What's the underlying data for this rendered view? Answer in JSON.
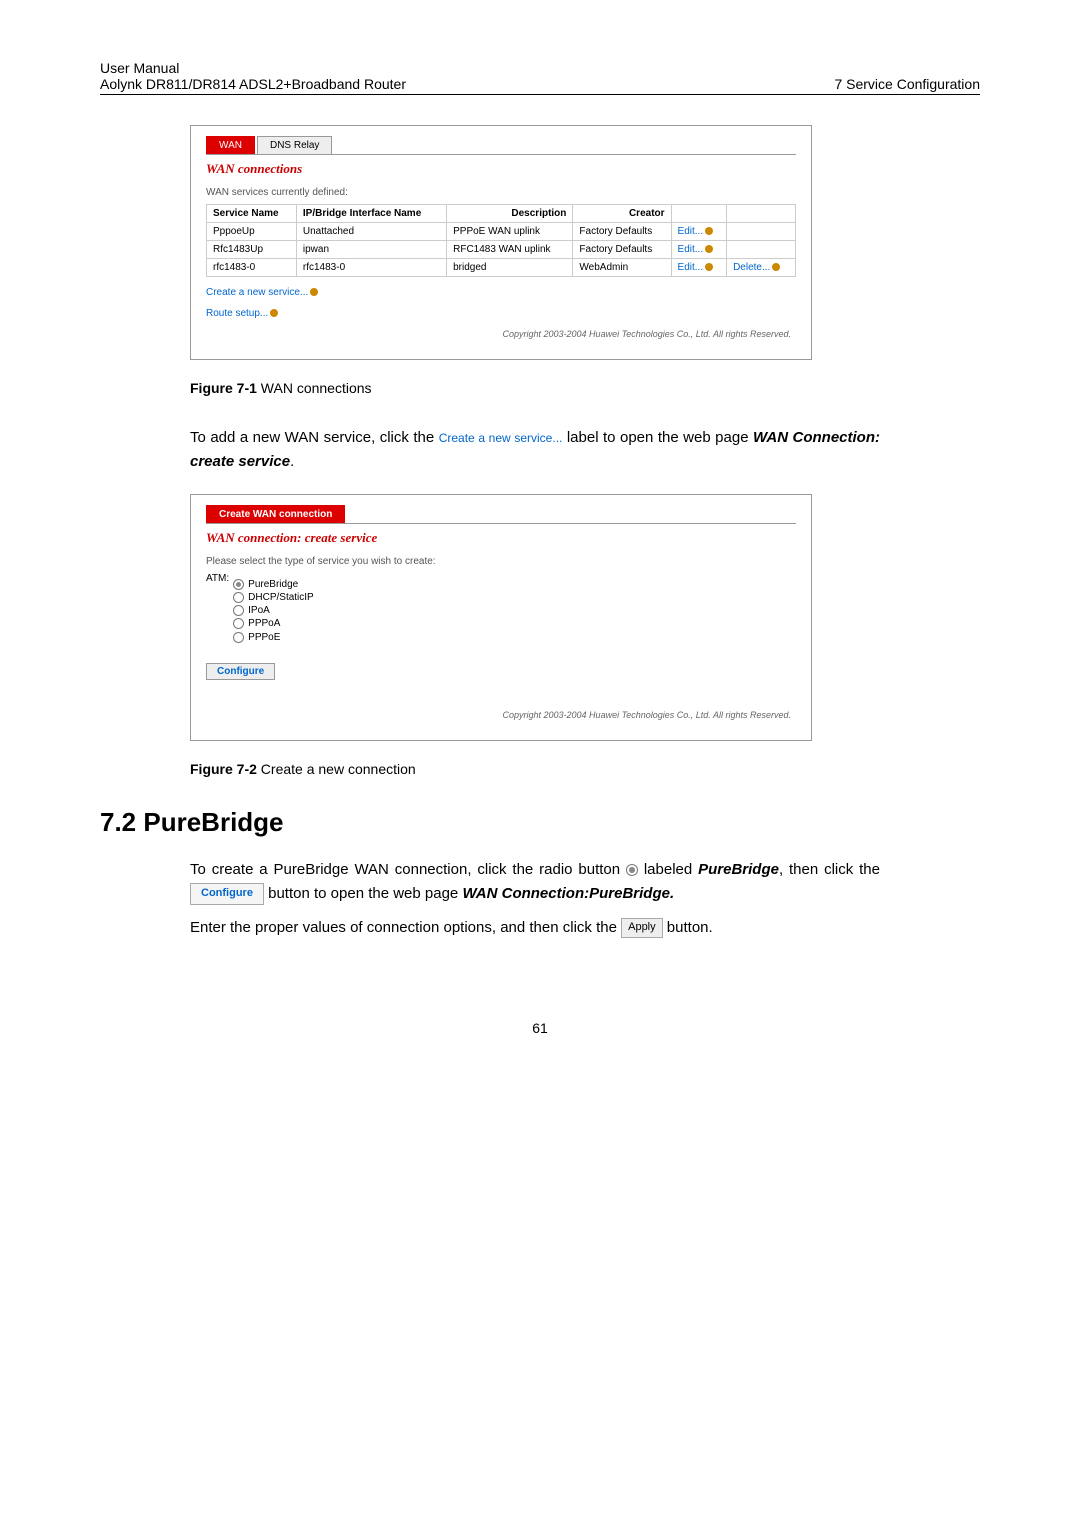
{
  "header": {
    "line1": "User Manual",
    "line2": "Aolynk DR811/DR814 ADSL2+Broadband Router",
    "right": "7  Service Configuration"
  },
  "fig1": {
    "tabs": [
      "WAN",
      "DNS Relay"
    ],
    "title": "WAN connections",
    "subtitle": "WAN services currently defined:",
    "cols": [
      "Service Name",
      "IP/Bridge Interface Name",
      "Description",
      "Creator",
      "",
      ""
    ],
    "rows": [
      {
        "c": [
          "PppoeUp",
          "Unattached",
          "PPPoE WAN uplink",
          "Factory Defaults",
          "Edit...",
          ""
        ]
      },
      {
        "c": [
          "Rfc1483Up",
          "ipwan",
          "RFC1483 WAN uplink",
          "Factory Defaults",
          "Edit...",
          ""
        ]
      },
      {
        "c": [
          "rfc1483-0",
          "rfc1483-0",
          "bridged",
          "WebAdmin",
          "Edit...",
          "Delete..."
        ]
      }
    ],
    "link1": "Create a new service...",
    "link2": "Route setup...",
    "copyright": "Copyright 2003-2004 Huawei Technologies Co., Ltd. All rights Reserved."
  },
  "caption1": {
    "bold": "Figure 7-1",
    "rest": " WAN connections"
  },
  "para1": {
    "pre": "To add a new WAN service, click the ",
    "link": "Create a new service...",
    "post": " label to open the web page ",
    "em": "WAN Connection: create service",
    "end": "."
  },
  "fig2": {
    "tab": "Create WAN connection",
    "title": "WAN connection: create service",
    "prompt": "Please select the type of service you wish to create:",
    "atm_label": "ATM:",
    "options": [
      "PureBridge",
      "DHCP/StaticIP",
      "IPoA",
      "PPPoA",
      "PPPoE"
    ],
    "btn": "Configure",
    "copyright": "Copyright 2003-2004 Huawei Technologies Co., Ltd. All rights Reserved."
  },
  "caption2": {
    "bold": "Figure 7-2",
    "rest": " Create a new connection"
  },
  "section": "7.2  PureBridge",
  "para2": {
    "t1": "To create a PureBridge WAN connection, click the radio button ",
    "t2": " labeled ",
    "em1": "PureBridge",
    "t3": ", then click the ",
    "btn": "Configure",
    "t4": " button to open the web page ",
    "em2": "WAN Connection:PureBridge."
  },
  "para3": {
    "t1": "Enter the proper values of connection options, and then click the ",
    "btn": "Apply",
    "t2": " button."
  },
  "page_number": "61"
}
